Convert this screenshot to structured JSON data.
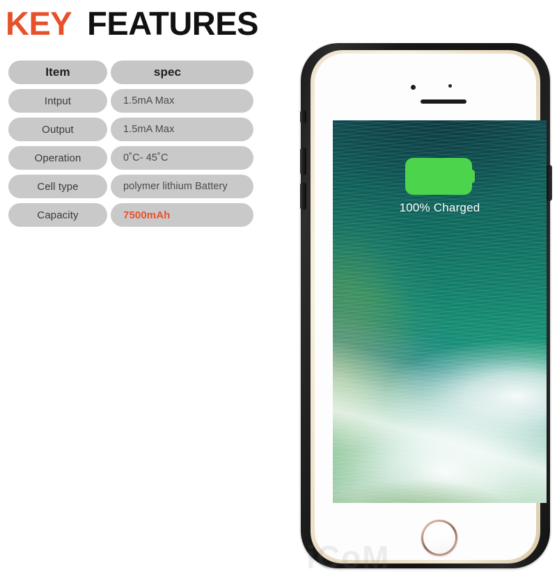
{
  "title": {
    "highlight": "KEY",
    "rest": "FEATURES",
    "highlight_color": "#E8502A",
    "rest_color": "#111111"
  },
  "spec_table": {
    "columns": [
      "Item",
      "spec"
    ],
    "rows": [
      {
        "item": "Intput",
        "spec": "1.5mA Max"
      },
      {
        "item": "Output",
        "spec": "1.5mA Max"
      },
      {
        "item": "Operation",
        "spec": "0˚C- 45˚C"
      },
      {
        "item": "Cell type",
        "spec": "polymer lithium Battery"
      },
      {
        "item": "Capacity",
        "spec": "7500mAh"
      }
    ],
    "accent_row_index": 4,
    "accent_color": "#E8502A",
    "cell_bg_color": "#C9C9C9",
    "label_text_color": "#3A3A3A",
    "value_text_color": "#4A4A4A"
  },
  "phone": {
    "case_color": "#141414",
    "bezel_color": "#EFE4CD",
    "face_color": "#FDFDFD",
    "screen": {
      "wallpaper": "ocean-wave-teal-green",
      "battery_icon": "battery-full-icon",
      "battery_color": "#4CD44C",
      "charge_status": "100% Charged",
      "charge_text_color": "#FFFFFF"
    },
    "home_button_ring_color": "#B98A78",
    "buttons": [
      "mute-switch",
      "volume-up",
      "volume-down",
      "power"
    ]
  },
  "watermark": {
    "text": "iCoM"
  }
}
